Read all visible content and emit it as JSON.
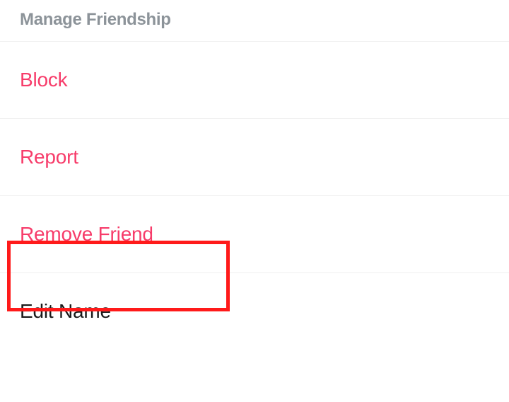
{
  "section": {
    "header": "Manage Friendship"
  },
  "menu": {
    "items": [
      {
        "label": "Block",
        "type": "destructive"
      },
      {
        "label": "Report",
        "type": "destructive"
      },
      {
        "label": "Remove Friend",
        "type": "destructive"
      },
      {
        "label": "Edit Name",
        "type": "normal"
      }
    ]
  },
  "colors": {
    "destructive": "#f73c6a",
    "normal": "#1a1a1a",
    "header": "#8c9399",
    "highlight": "#ff1a1a"
  }
}
